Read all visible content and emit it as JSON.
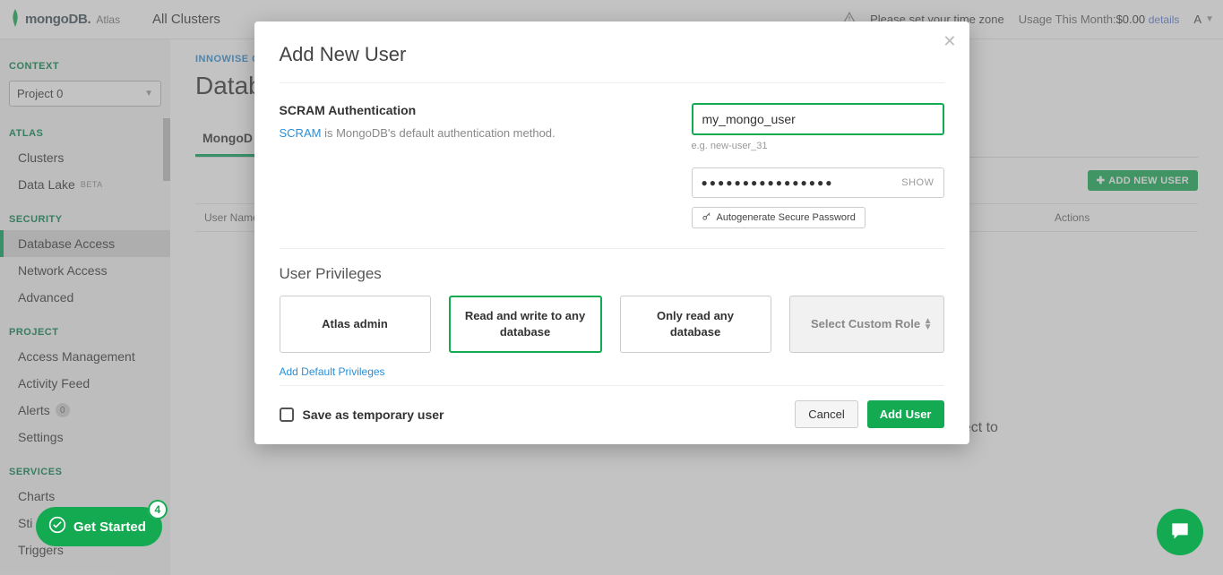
{
  "topbar": {
    "brand_main": "mongoDB.",
    "brand_sub": "Atlas",
    "all_clusters": "All Clusters",
    "tz_warning": "Please set your time zone",
    "usage_label": "Usage This Month:",
    "usage_value": "$0.00",
    "details": "details",
    "user_initial": "A"
  },
  "sidebar": {
    "context_label": "CONTEXT",
    "project_selected": "Project 0",
    "atlas_label": "ATLAS",
    "atlas_items": [
      "Clusters",
      "Data Lake"
    ],
    "beta_badge": "BETA",
    "security_label": "SECURITY",
    "security_items": [
      "Database Access",
      "Network Access",
      "Advanced"
    ],
    "project_label": "PROJECT",
    "project_items": [
      "Access Management",
      "Activity Feed",
      "Alerts",
      "Settings"
    ],
    "alerts_count": "0",
    "services_label": "SERVICES",
    "services_items": [
      "Charts",
      "Sti",
      "Triggers"
    ]
  },
  "content": {
    "crumb": "INNOWISE GROU",
    "page_title": "Databa",
    "tab_label": "MongoD",
    "add_user_btn": "ADD NEW USER",
    "th_user": "User Name",
    "th_actions": "Actions",
    "hint": "nnect to"
  },
  "get_started": {
    "label": "Get Started",
    "badge": "4"
  },
  "modal": {
    "title": "Add New User",
    "scram_title": "SCRAM Authentication",
    "scram_link": "SCRAM",
    "scram_desc": " is MongoDB's default authentication method.",
    "username_value": "my_mongo_user",
    "username_hint": "e.g. new-user_31",
    "password_masked": "●●●●●●●●●●●●●●●●",
    "show": "SHOW",
    "autogen": "Autogenerate Secure Password",
    "priv_title": "User Privileges",
    "priv_options": [
      "Atlas admin",
      "Read and write to any database",
      "Only read any database",
      "Select Custom Role"
    ],
    "add_default": "Add Default Privileges",
    "temp_user_label": "Save as temporary user",
    "cancel": "Cancel",
    "add_user": "Add User"
  }
}
